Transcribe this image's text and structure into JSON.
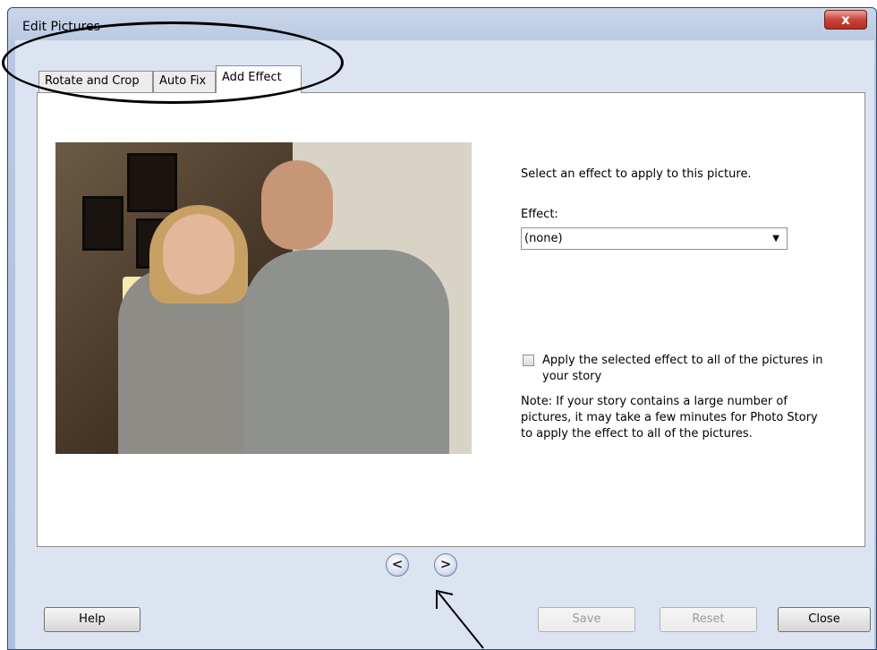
{
  "window": {
    "title": "Edit Pictures",
    "close_glyph": "x"
  },
  "tabs": [
    {
      "label": "Rotate and Crop",
      "active": false
    },
    {
      "label": "Auto Fix",
      "active": false
    },
    {
      "label": "Add Effect",
      "active": true
    }
  ],
  "panel": {
    "instruction": "Select an effect to apply to this picture.",
    "effect_label": "Effect:",
    "effect_value": "(none)",
    "apply_all_label": "Apply the selected effect to all of the pictures in your story",
    "apply_all_checked": false,
    "note": "Note: If your story contains a large number of pictures, it may take a few minutes for Photo Story to apply the effect to all of the pictures."
  },
  "navigation": {
    "prev_glyph": "<",
    "next_glyph": ">"
  },
  "buttons": {
    "help": "Help",
    "save": "Save",
    "reset": "Reset",
    "close": "Close"
  },
  "colors": {
    "window_frame": "#b9c8e2",
    "close_button": "#c8433a",
    "annotation": "#000000"
  }
}
